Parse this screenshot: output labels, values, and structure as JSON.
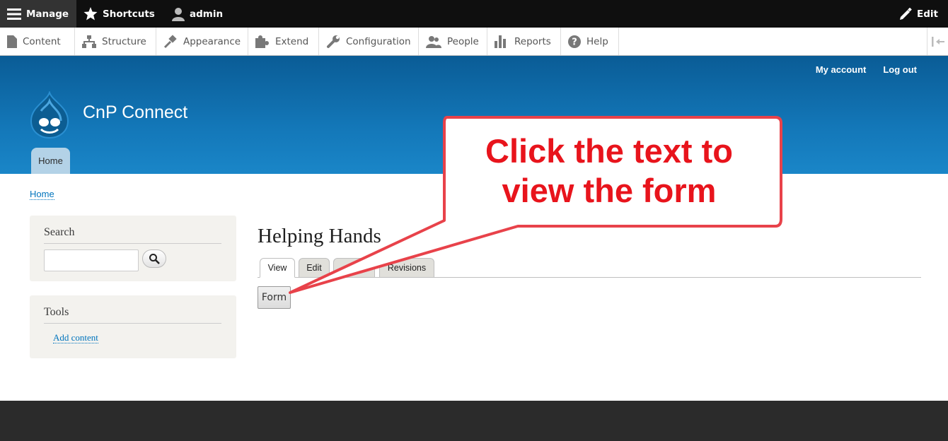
{
  "toolbar": {
    "manage_label": "Manage",
    "shortcuts_label": "Shortcuts",
    "user_label": "admin",
    "edit_label": "Edit"
  },
  "tray": {
    "items": [
      {
        "label": "Content",
        "icon": "file-icon"
      },
      {
        "label": "Structure",
        "icon": "sitemap-icon"
      },
      {
        "label": "Appearance",
        "icon": "paintbrush-icon"
      },
      {
        "label": "Extend",
        "icon": "puzzle-icon"
      },
      {
        "label": "Configuration",
        "icon": "wrench-icon"
      },
      {
        "label": "People",
        "icon": "people-icon"
      },
      {
        "label": "Reports",
        "icon": "bar-chart-icon"
      },
      {
        "label": "Help",
        "icon": "question-icon"
      }
    ]
  },
  "header": {
    "site_name": "CnP Connect",
    "secondary_menu": [
      "My account",
      "Log out"
    ],
    "main_menu": [
      "Home"
    ]
  },
  "breadcrumb": [
    "Home"
  ],
  "sidebar": {
    "search_title": "Search",
    "tools_title": "Tools",
    "tools_links": [
      "Add content"
    ]
  },
  "main": {
    "title": "Helping Hands",
    "tabs": [
      "View",
      "Edit",
      "D",
      "Revisions"
    ],
    "active_tab": "View",
    "form_button_label": "Form"
  },
  "callout": {
    "line1": "Click the text to",
    "line2": "view the form",
    "color": "#e8141c"
  },
  "colors": {
    "header_blue": "#1377b8",
    "link_blue": "#0074bd",
    "footer": "#2b2b2b"
  }
}
